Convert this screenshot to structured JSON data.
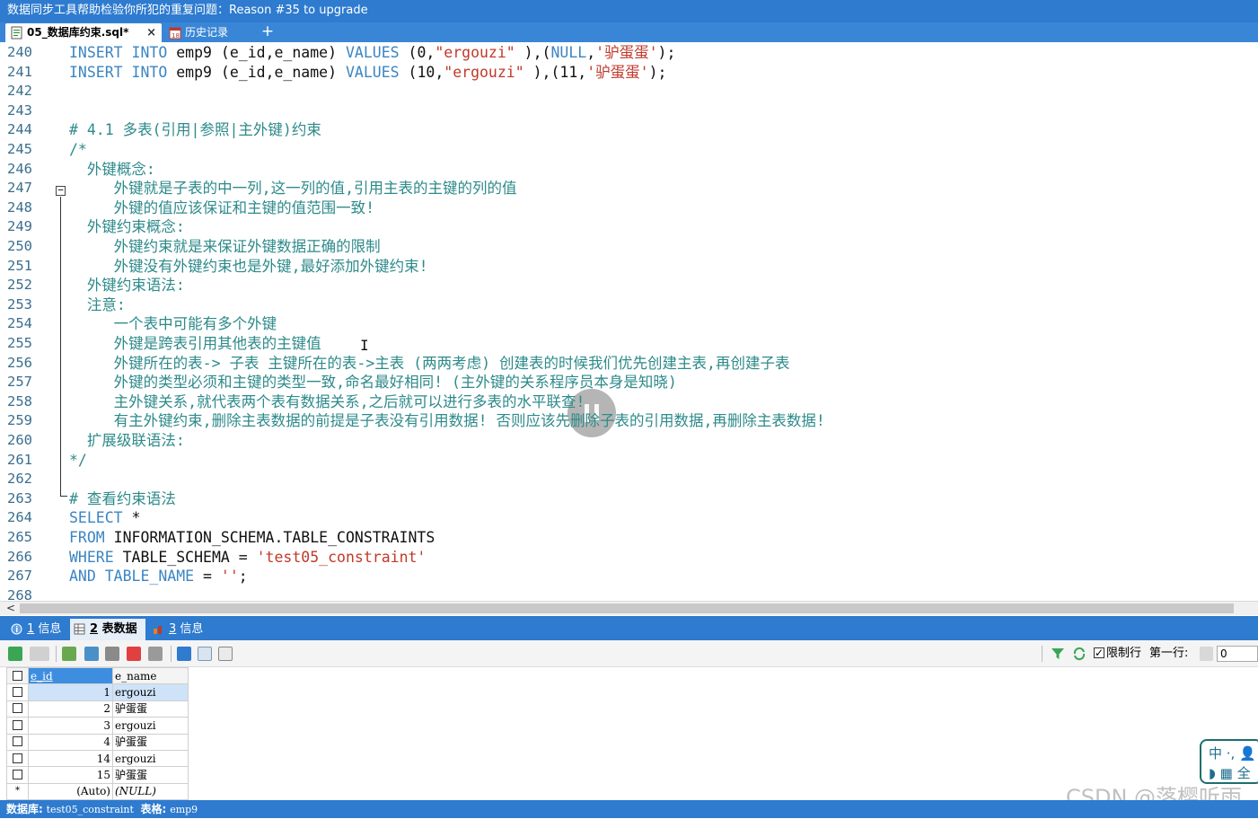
{
  "window": {
    "title": "数据同步工具帮助检验你所犯的重复问题：Reason #35 to upgrade"
  },
  "tabs": [
    {
      "label": "05_数据库约束.sql*",
      "active": true,
      "close": "×"
    },
    {
      "label": "历史记录",
      "active": false
    }
  ],
  "tab_add": "+",
  "editor": {
    "lines": [
      {
        "n": "240",
        "segs": [
          [
            "kw",
            "INSERT INTO "
          ],
          [
            "pl",
            "emp9 (e_id,e_name) "
          ],
          [
            "kw",
            "VALUES "
          ],
          [
            "pl",
            "(0,"
          ],
          [
            "str",
            "\"ergouzi\""
          ],
          [
            "pl",
            " ),("
          ],
          [
            "kw",
            "NULL"
          ],
          [
            "pl",
            ","
          ],
          [
            "str",
            "'驴蛋蛋'"
          ],
          [
            "pl",
            ");"
          ]
        ]
      },
      {
        "n": "241",
        "segs": [
          [
            "kw",
            "INSERT INTO "
          ],
          [
            "pl",
            "emp9 (e_id,e_name) "
          ],
          [
            "kw",
            "VALUES "
          ],
          [
            "pl",
            "(10,"
          ],
          [
            "str",
            "\"ergouzi\""
          ],
          [
            "pl",
            " ),(11,"
          ],
          [
            "str",
            "'驴蛋蛋'"
          ],
          [
            "pl",
            ");"
          ]
        ]
      },
      {
        "n": "242",
        "segs": []
      },
      {
        "n": "243",
        "segs": []
      },
      {
        "n": "244",
        "segs": [
          [
            "cm",
            "# 4.1 多表(引用|参照|主外键)约束"
          ]
        ]
      },
      {
        "n": "245",
        "segs": [
          [
            "cm",
            "/*"
          ]
        ]
      },
      {
        "n": "246",
        "segs": [
          [
            "cm",
            "  外键概念:"
          ]
        ]
      },
      {
        "n": "247",
        "segs": [
          [
            "cm",
            "     外键就是子表的中一列,这一列的值,引用主表的主键的列的值"
          ]
        ]
      },
      {
        "n": "248",
        "segs": [
          [
            "cm",
            "     外键的值应该保证和主键的值范围一致!"
          ]
        ]
      },
      {
        "n": "249",
        "segs": [
          [
            "cm",
            "  外键约束概念:"
          ]
        ]
      },
      {
        "n": "250",
        "segs": [
          [
            "cm",
            "     外键约束就是来保证外键数据正确的限制"
          ]
        ]
      },
      {
        "n": "251",
        "segs": [
          [
            "cm",
            "     外键没有外键约束也是外键,最好添加外键约束!"
          ]
        ]
      },
      {
        "n": "252",
        "segs": [
          [
            "cm",
            "  外键约束语法:"
          ]
        ]
      },
      {
        "n": "253",
        "segs": [
          [
            "cm",
            "  注意:"
          ]
        ]
      },
      {
        "n": "254",
        "segs": [
          [
            "cm",
            "     一个表中可能有多个外键"
          ]
        ]
      },
      {
        "n": "255",
        "segs": [
          [
            "cm",
            "     外键是跨表引用其他表的主键值"
          ]
        ]
      },
      {
        "n": "256",
        "segs": [
          [
            "cm",
            "     外键所在的表-> 子表 主键所在的表->主表 (两两考虑) 创建表的时候我们优先创建主表,再创建子表"
          ]
        ]
      },
      {
        "n": "257",
        "segs": [
          [
            "cm",
            "     外键的类型必须和主键的类型一致,命名最好相同! (主外键的关系程序员本身是知晓)"
          ]
        ]
      },
      {
        "n": "258",
        "segs": [
          [
            "cm",
            "     主外键关系,就代表两个表有数据关系,之后就可以进行多表的水平联查!"
          ]
        ]
      },
      {
        "n": "259",
        "segs": [
          [
            "cm",
            "     有主外键约束,删除主表数据的前提是子表没有引用数据! 否则应该先删除子表的引用数据,再删除主表数据!"
          ]
        ]
      },
      {
        "n": "260",
        "segs": [
          [
            "cm",
            "  扩展级联语法:"
          ]
        ]
      },
      {
        "n": "261",
        "segs": [
          [
            "cm",
            "*/"
          ]
        ]
      },
      {
        "n": "262",
        "segs": []
      },
      {
        "n": "263",
        "segs": [
          [
            "cm",
            "# 查看约束语法"
          ]
        ]
      },
      {
        "n": "264",
        "segs": [
          [
            "kw",
            "SELECT "
          ],
          [
            "pl",
            "*"
          ]
        ]
      },
      {
        "n": "265",
        "segs": [
          [
            "kw",
            "FROM "
          ],
          [
            "pl",
            "INFORMATION_SCHEMA.TABLE_CONSTRAINTS"
          ]
        ]
      },
      {
        "n": "266",
        "segs": [
          [
            "kw",
            "WHERE "
          ],
          [
            "pl",
            "TABLE_SCHEMA = "
          ],
          [
            "str",
            "'test05_constraint'"
          ]
        ]
      },
      {
        "n": "267",
        "segs": [
          [
            "kw",
            "AND TABLE_NAME "
          ],
          [
            "pl",
            "= "
          ],
          [
            "str",
            "''"
          ],
          [
            "pl",
            ";"
          ]
        ]
      },
      {
        "n": "268",
        "segs": []
      }
    ],
    "cursor_glyph": "I"
  },
  "scroll_left_arrow": "<",
  "result_tabs": [
    {
      "num": "1",
      "label": "信息",
      "active": false
    },
    {
      "num": "2",
      "label": "表数据",
      "active": true
    },
    {
      "num": "3",
      "label": "信息",
      "active": false
    }
  ],
  "toolbar": {
    "limit_label": "限制行",
    "limit_checked": true,
    "first_row_label": "第一行:",
    "first_row_value": "0"
  },
  "grid": {
    "columns": [
      "e_id",
      "e_name"
    ],
    "rows": [
      {
        "marker": "",
        "id": "1",
        "name": "ergouzi"
      },
      {
        "marker": "",
        "id": "2",
        "name": "驴蛋蛋"
      },
      {
        "marker": "",
        "id": "3",
        "name": "ergouzi"
      },
      {
        "marker": "",
        "id": "4",
        "name": "驴蛋蛋"
      },
      {
        "marker": "",
        "id": "14",
        "name": "ergouzi"
      },
      {
        "marker": "",
        "id": "15",
        "name": "驴蛋蛋"
      },
      {
        "marker": "*",
        "id": "(Auto)",
        "name": "(NULL)"
      }
    ]
  },
  "ime": {
    "row1": "中 ·, 👤",
    "row2": "◗ ▦ 全"
  },
  "watermark": "CSDN @落樱听雨",
  "status": {
    "db_label": "数据库:",
    "db_value": "test05_constraint",
    "table_label": "表格:",
    "table_value": "emp9"
  }
}
